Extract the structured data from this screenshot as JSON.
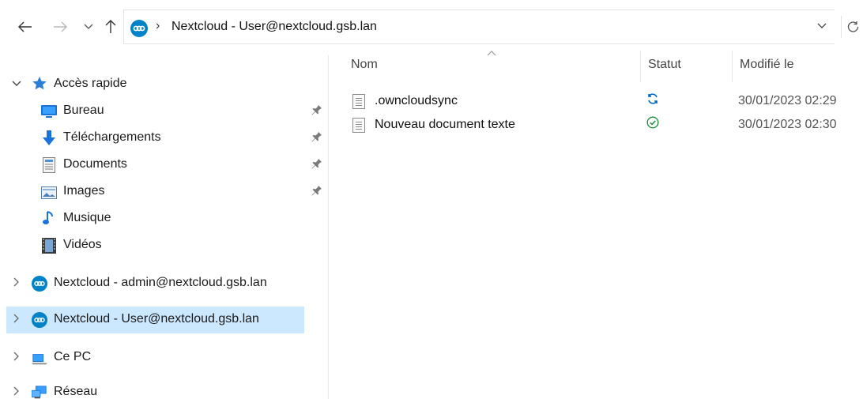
{
  "address_bar": {
    "path": "Nextcloud - User@nextcloud.gsb.lan"
  },
  "nav_pane": {
    "quick_access": {
      "label": "Accès rapide",
      "items": [
        {
          "label": "Bureau",
          "icon": "desktop-icon",
          "pinned": true
        },
        {
          "label": "Téléchargements",
          "icon": "download-icon",
          "pinned": true
        },
        {
          "label": "Documents",
          "icon": "documents-icon",
          "pinned": true
        },
        {
          "label": "Images",
          "icon": "images-icon",
          "pinned": true
        },
        {
          "label": "Musique",
          "icon": "music-icon",
          "pinned": false
        },
        {
          "label": "Vidéos",
          "icon": "videos-icon",
          "pinned": false
        }
      ]
    },
    "locations": [
      {
        "label": "Nextcloud - admin@nextcloud.gsb.lan",
        "icon": "nextcloud-icon",
        "selected": false
      },
      {
        "label": "Nextcloud - User@nextcloud.gsb.lan",
        "icon": "nextcloud-icon",
        "selected": true
      },
      {
        "label": "Ce PC",
        "icon": "computer-icon",
        "selected": false
      },
      {
        "label": "Réseau",
        "icon": "network-icon",
        "selected": false
      }
    ]
  },
  "file_list": {
    "columns": {
      "name": "Nom",
      "status": "Statut",
      "modified": "Modifié le"
    },
    "files": [
      {
        "name": ".owncloudsync",
        "status": "syncing",
        "modified": "30/01/2023 02:29"
      },
      {
        "name": "Nouveau document texte",
        "status": "synced",
        "modified": "30/01/2023 02:30"
      }
    ]
  },
  "colors": {
    "selection": "#cce8ff",
    "nextcloud_blue": "#0082c9",
    "sync_blue": "#0067c0",
    "synced_green": "#1e8f3a",
    "quick_access_star": "#2a7fd4"
  }
}
